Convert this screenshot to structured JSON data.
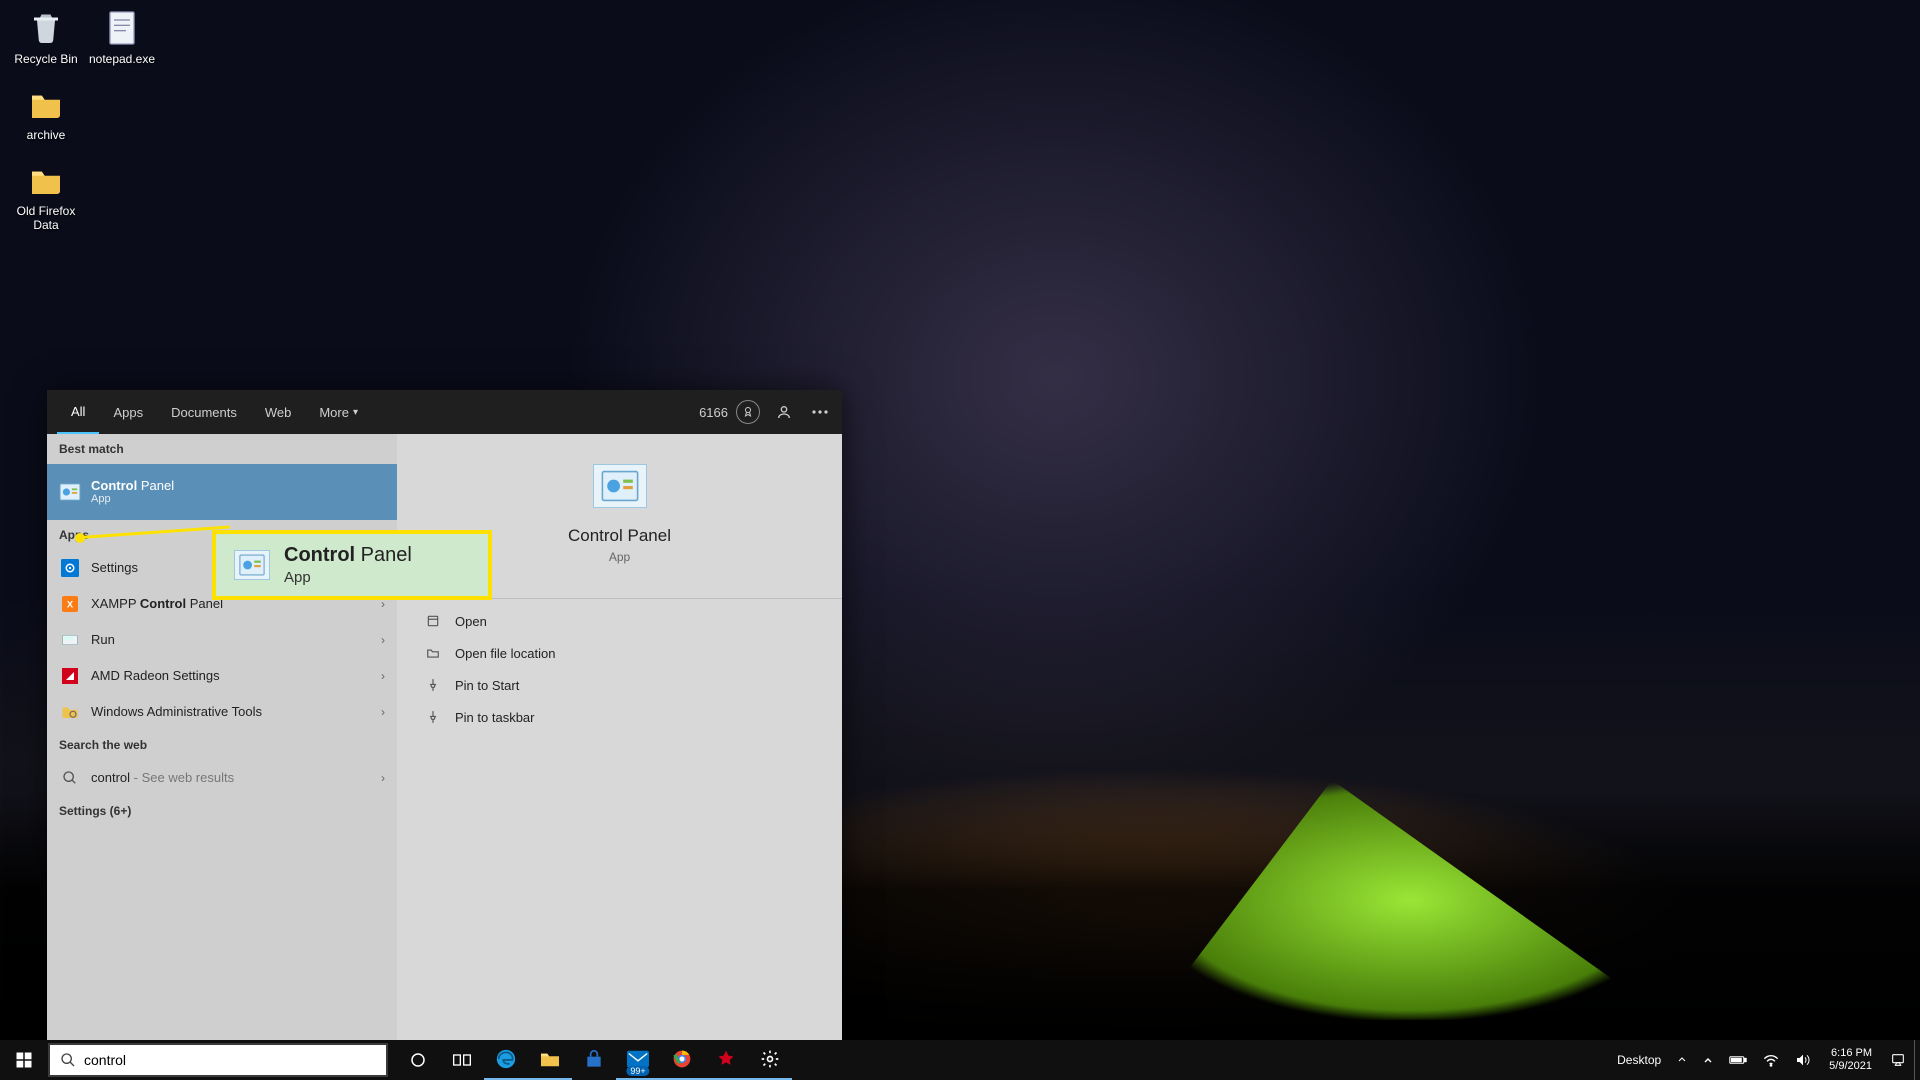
{
  "desktop_icons": {
    "recycle": "Recycle Bin",
    "notepad": "notepad.exe",
    "archive": "archive",
    "firefox": "Old Firefox Data"
  },
  "search_panel": {
    "tabs": {
      "all": "All",
      "apps": "Apps",
      "documents": "Documents",
      "web": "Web",
      "more": "More"
    },
    "points": "6166",
    "sections": {
      "best_match": "Best match",
      "apps": "Apps",
      "search_web": "Search the web",
      "settings_more": "Settings (6+)"
    },
    "best_match_item": {
      "bold": "Control",
      "rest": " Panel",
      "sub": "App"
    },
    "apps_list": {
      "settings": "Settings",
      "xampp_pre": "XAMPP ",
      "xampp_bold": "Control",
      "xampp_post": " Panel",
      "run": "Run",
      "amd": "AMD Radeon Settings",
      "wintools": "Windows Administrative Tools"
    },
    "web_result": {
      "query": "control",
      "suffix": " - See web results"
    },
    "preview": {
      "title": "Control Panel",
      "sub": "App"
    },
    "actions": {
      "open": "Open",
      "open_loc": "Open file location",
      "pin_start": "Pin to Start",
      "pin_taskbar": "Pin to taskbar"
    }
  },
  "callout": {
    "bold": "Control",
    "rest": " Panel",
    "sub": "App"
  },
  "taskbar": {
    "search_value": "control",
    "badge_count": "99+",
    "tray": {
      "desktop": "Desktop",
      "time": "6:16 PM",
      "date": "5/9/2021"
    }
  }
}
